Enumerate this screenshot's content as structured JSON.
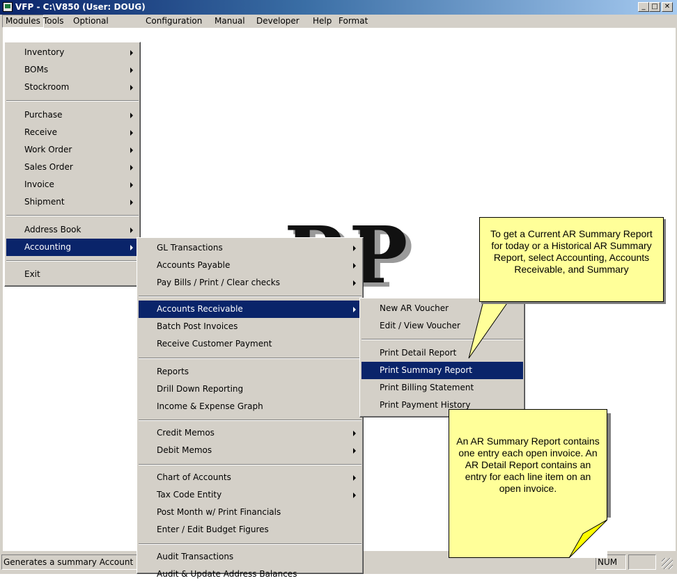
{
  "window": {
    "title": "VFP - C:\\V850  (User: DOUG)",
    "buttons": {
      "minimize": "_",
      "maximize": "□",
      "close": "✕"
    }
  },
  "menubar": [
    "Modules",
    "Tools",
    "Optional",
    "Configuration",
    "Manual",
    "Developer",
    "Help",
    "Format"
  ],
  "background_logo": "RP",
  "modules_menu": [
    "Inventory",
    "BOMs",
    "Stockroom",
    "Purchase",
    "Receive",
    "Work Order",
    "Sales Order",
    "Invoice",
    "Shipment",
    "Address Book",
    "Accounting",
    "Exit"
  ],
  "accounting_menu": [
    "GL Transactions",
    "Accounts Payable",
    "Pay Bills / Print / Clear checks",
    "Accounts Receivable",
    "Batch Post Invoices",
    "Receive Customer Payment",
    "Reports",
    "Drill Down Reporting",
    "Income & Expense Graph",
    "Credit Memos",
    "Debit Memos",
    "Chart of Accounts",
    "Tax Code Entity",
    "Post Month w/ Print Financials",
    "Enter / Edit Budget Figures",
    "Audit Transactions",
    "Audit & Update Address Balances"
  ],
  "ar_menu": [
    "New AR Voucher",
    "Edit / View Voucher",
    "Print Detail Report",
    "Print Summary Report",
    "Print Billing Statement",
    "Print Payment History"
  ],
  "callouts": {
    "top": "To get a Current AR Summary Report for today or a Historical AR Summary Report, select Accounting, Accounts Receivable, and Summary",
    "bottom": "An AR Summary Report contains one entry each open invoice.  An AR Detail Report contains an entry for each line item on an open invoice."
  },
  "statusbar": {
    "message": "Generates a summary Account",
    "num": "NUM"
  },
  "colors": {
    "highlight": "#0a246a",
    "callout": "#ffff99",
    "face": "#d4d0c8"
  }
}
